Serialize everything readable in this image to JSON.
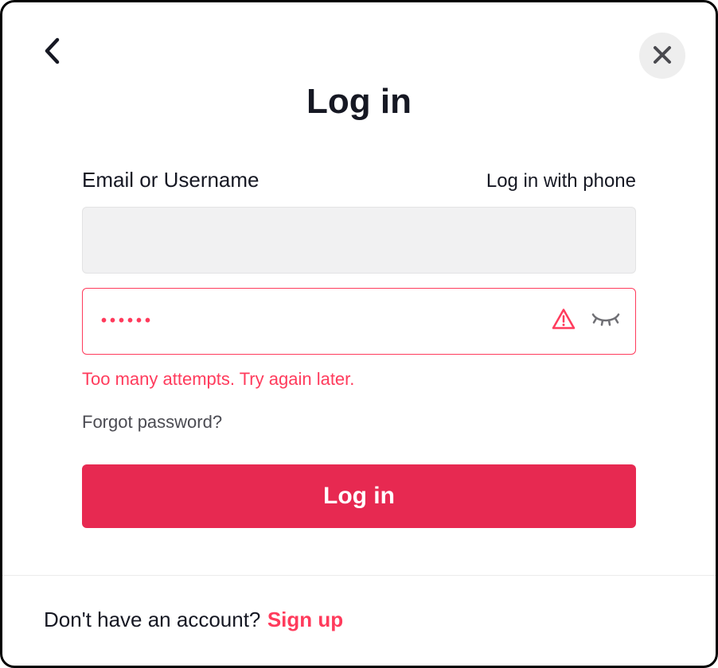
{
  "title": "Log in",
  "form": {
    "field_label": "Email or Username",
    "phone_link": "Log in with phone",
    "email_value": "",
    "password_masked": "••••••",
    "error_message": "Too many attempts. Try again later.",
    "forgot_label": "Forgot password?",
    "submit_label": "Log in"
  },
  "footer": {
    "prompt": "Don't have an account?",
    "signup_label": "Sign up"
  }
}
